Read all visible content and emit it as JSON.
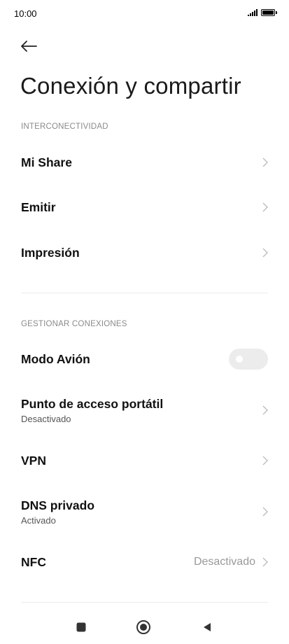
{
  "status_bar": {
    "time": "10:00"
  },
  "header": {
    "title": "Conexión y compartir"
  },
  "sections": {
    "interconnectivity": {
      "header": "INTERCONECTIVIDAD",
      "items": [
        {
          "label": "Mi Share"
        },
        {
          "label": "Emitir"
        },
        {
          "label": "Impresión"
        }
      ]
    },
    "connections": {
      "header": "GESTIONAR CONEXIONES",
      "items": [
        {
          "label": "Modo Avión",
          "toggle": "off"
        },
        {
          "label": "Punto de acceso portátil",
          "sub": "Desactivado"
        },
        {
          "label": "VPN"
        },
        {
          "label": "DNS privado",
          "sub": "Activado"
        },
        {
          "label": "NFC",
          "value": "Desactivado"
        }
      ]
    }
  },
  "icons": {
    "back": "arrow-left-icon",
    "chevron": "chevron-right-icon",
    "signal": "signal-icon",
    "battery": "battery-icon",
    "nav_recents": "square-icon",
    "nav_home": "circle-icon",
    "nav_back": "triangle-back-icon"
  },
  "colors": {
    "background": "#ffffff",
    "section_header": "#8a8a8a",
    "toggle_off": "#ececec",
    "value_text": "#999999"
  }
}
